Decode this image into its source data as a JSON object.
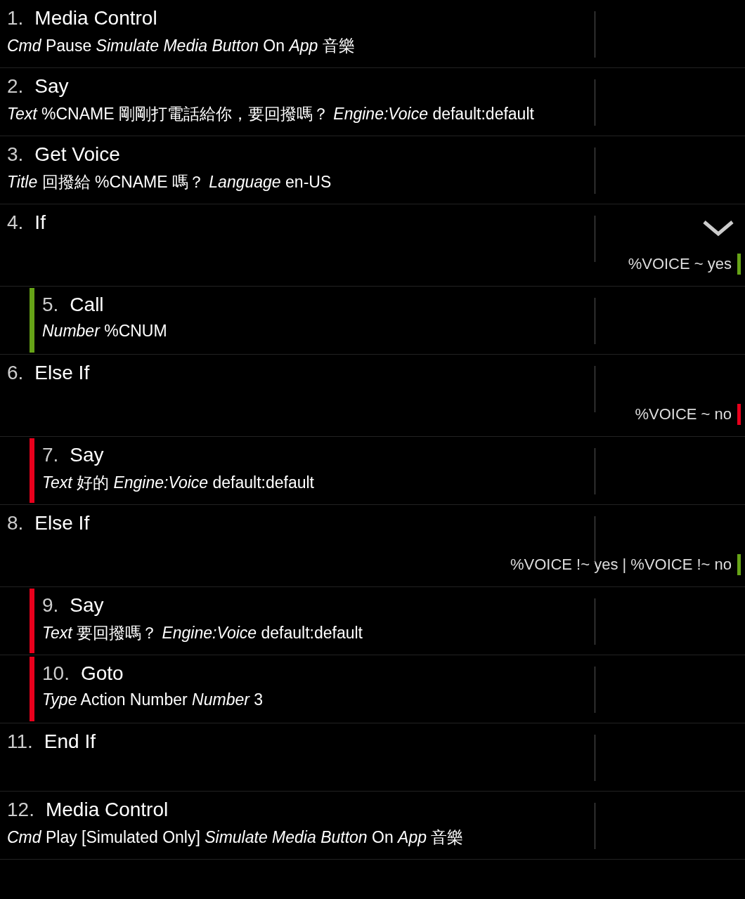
{
  "actions": [
    {
      "number": "1.",
      "title": "Media Control",
      "params": "*Cmd* Pause *Simulate Media Button* On *App* 音樂"
    },
    {
      "number": "2.",
      "title": "Say",
      "params": "*Text* %CNAME 剛剛打電話給你，要回撥嗎？ *Engine:Voice* default:default"
    },
    {
      "number": "3.",
      "title": "Get Voice",
      "params": "*Title* 回撥給 %CNAME 嗎？ *Language* en-US"
    },
    {
      "number": "4.",
      "title": "If",
      "expanded": true,
      "condition": {
        "text": "%VOICE ~ yes",
        "color": "#66a317"
      },
      "children": [
        {
          "number": "5.",
          "title": "Call",
          "params": "*Number* %CNUM",
          "color": "#66a317"
        }
      ]
    },
    {
      "number": "6.",
      "title": "Else If",
      "condition": {
        "text": "%VOICE ~ no",
        "color": "#e8001c"
      },
      "children": [
        {
          "number": "7.",
          "title": "Say",
          "params": "*Text* 好的 *Engine:Voice* default:default",
          "color": "#e8001c"
        }
      ]
    },
    {
      "number": "8.",
      "title": "Else If",
      "condition": {
        "text": "%VOICE !~ yes | %VOICE !~ no",
        "color": "#66a317"
      },
      "children": [
        {
          "number": "9.",
          "title": "Say",
          "params": "*Text* 要回撥嗎？ *Engine:Voice* default:default",
          "color": "#e8001c"
        },
        {
          "number": "10.",
          "title": "Goto",
          "params": "*Type* Action Number *Number* 3",
          "color": "#e8001c"
        }
      ]
    },
    {
      "number": "11.",
      "title": "End If"
    },
    {
      "number": "12.",
      "title": "Media Control",
      "params": "*Cmd* Play [Simulated Only] *Simulate Media Button* On *App* 音樂"
    }
  ]
}
